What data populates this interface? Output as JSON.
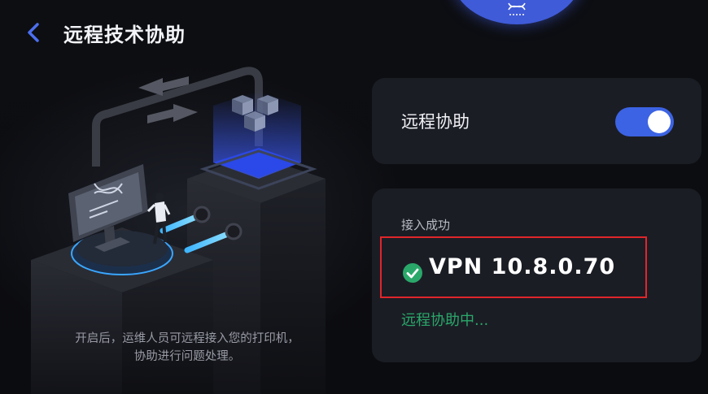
{
  "header": {
    "back_icon": "chevron-left-icon",
    "title": "远程技术协助"
  },
  "illustration": {
    "caption": "开启后，运维人员可远程接入您的打印机，\n协助进行问题处理。"
  },
  "toggle_card": {
    "label": "远程协助",
    "enabled": true
  },
  "status_card": {
    "label": "接入成功",
    "vpn_text": "VPN 10.8.0.70",
    "progress_text": "远程协助中..."
  },
  "colors": {
    "accent": "#3c63e3",
    "success": "#2aa86a",
    "highlight_border": "#e0262a",
    "card_bg": "#1b1d25"
  }
}
